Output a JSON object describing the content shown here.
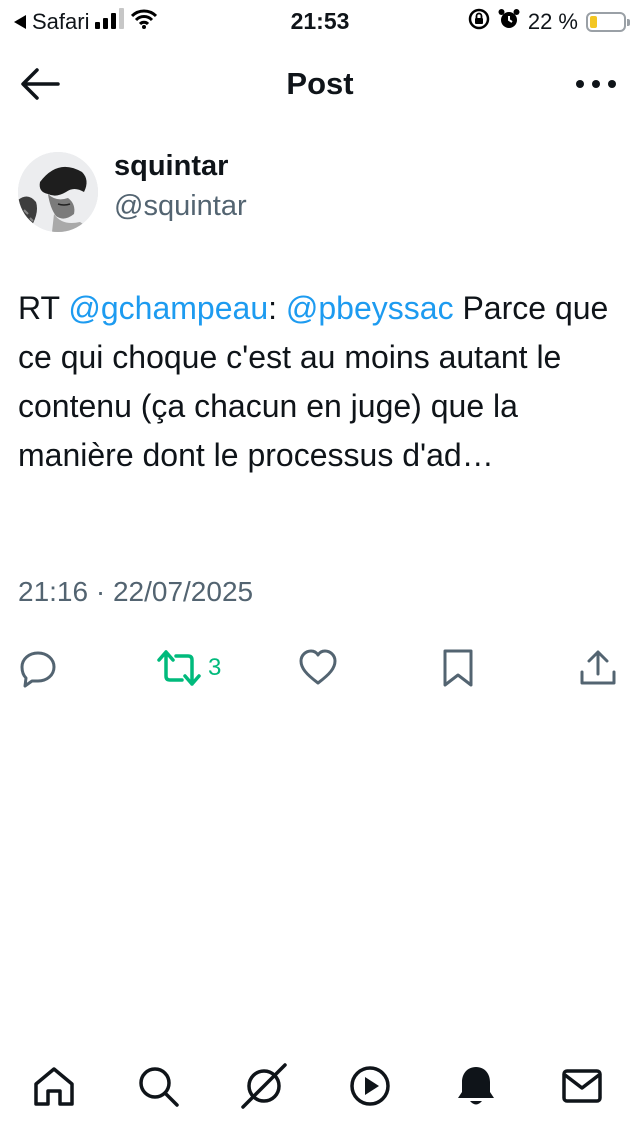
{
  "status_bar": {
    "back_app": "Safari",
    "time": "21:53",
    "battery_text": "22 %",
    "battery_level": 0.22
  },
  "nav": {
    "title": "Post",
    "back_icon": "arrow-left-icon",
    "more_icon": "more-horizontal-icon"
  },
  "post": {
    "author_name": "squintar",
    "author_handle": "@squintar",
    "text_prefix": "RT ",
    "mention_1": "@gchampeau",
    "sep": ": ",
    "mention_2": "@pbeyssac",
    "body": " Parce que ce qui choque c'est au moins autant le contenu (ça chacun en juge) que la manière dont le processus d'ad…",
    "timestamp": "21:16 · 22/07/2025",
    "retweet_count": "3"
  },
  "actions": {
    "reply_icon": "reply-icon",
    "retweet_icon": "retweet-icon",
    "like_icon": "heart-icon",
    "bookmark_icon": "bookmark-icon",
    "share_icon": "share-icon",
    "retweet_active_color": "#00ba7c",
    "icon_color": "#536471"
  },
  "tabbar": {
    "items": [
      "home-icon",
      "search-icon",
      "grok-icon",
      "video-icon",
      "notifications-icon",
      "messages-icon"
    ]
  },
  "colors": {
    "mention": "#1d9bf0",
    "secondary_text": "#536471",
    "primary_text": "#0f1419"
  }
}
